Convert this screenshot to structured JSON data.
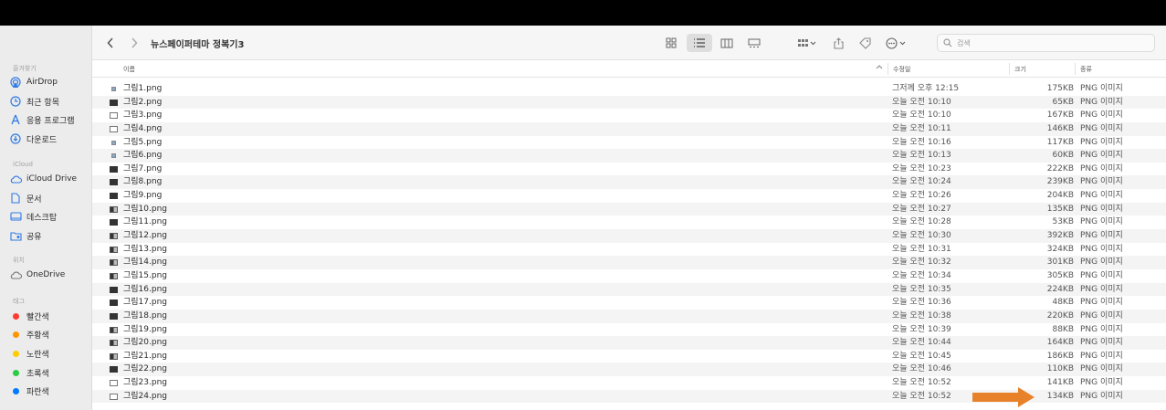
{
  "window": {
    "folder_title": "뉴스페이퍼테마 정복기3",
    "search_placeholder": "검색"
  },
  "sidebar": {
    "sections": {
      "favorites": "즐겨찾기",
      "icloud": "iCloud",
      "locations": "위치",
      "tags": "태그"
    },
    "favorites": [
      {
        "label": "AirDrop",
        "icon": "airdrop-icon"
      },
      {
        "label": "최근 항목",
        "icon": "clock-icon"
      },
      {
        "label": "응용 프로그램",
        "icon": "applications-icon"
      },
      {
        "label": "다운로드",
        "icon": "download-icon"
      }
    ],
    "icloud": [
      {
        "label": "iCloud Drive",
        "icon": "cloud-icon"
      },
      {
        "label": "문서",
        "icon": "document-icon"
      },
      {
        "label": "데스크탑",
        "icon": "desktop-icon"
      },
      {
        "label": "공유",
        "icon": "shared-folder-icon"
      }
    ],
    "locations": [
      {
        "label": "OneDrive",
        "icon": "cloud-icon"
      }
    ],
    "tags": [
      {
        "label": "빨간색",
        "color": "#ff3b30"
      },
      {
        "label": "주황색",
        "color": "#ff9500"
      },
      {
        "label": "노란색",
        "color": "#ffcc00"
      },
      {
        "label": "초록색",
        "color": "#28cd41"
      },
      {
        "label": "파란색",
        "color": "#007aff"
      }
    ]
  },
  "columns": {
    "name": "이름",
    "date": "수정일",
    "size": "크기",
    "kind": "종류"
  },
  "files": [
    {
      "name": "그림1.png",
      "date": "그저께 오후 12:15",
      "size": "175KB",
      "kind": "PNG 이미지",
      "thumb": "tiny"
    },
    {
      "name": "그림2.png",
      "date": "오늘 오전 10:10",
      "size": "65KB",
      "kind": "PNG 이미지",
      "thumb": "dark"
    },
    {
      "name": "그림3.png",
      "date": "오늘 오전 10:10",
      "size": "167KB",
      "kind": "PNG 이미지",
      "thumb": "light"
    },
    {
      "name": "그림4.png",
      "date": "오늘 오전 10:11",
      "size": "146KB",
      "kind": "PNG 이미지",
      "thumb": "light"
    },
    {
      "name": "그림5.png",
      "date": "오늘 오전 10:16",
      "size": "117KB",
      "kind": "PNG 이미지",
      "thumb": "tiny"
    },
    {
      "name": "그림6.png",
      "date": "오늘 오전 10:13",
      "size": "60KB",
      "kind": "PNG 이미지",
      "thumb": "tiny"
    },
    {
      "name": "그림7.png",
      "date": "오늘 오전 10:23",
      "size": "222KB",
      "kind": "PNG 이미지",
      "thumb": "dark"
    },
    {
      "name": "그림8.png",
      "date": "오늘 오전 10:24",
      "size": "239KB",
      "kind": "PNG 이미지",
      "thumb": "dark"
    },
    {
      "name": "그림9.png",
      "date": "오늘 오전 10:26",
      "size": "204KB",
      "kind": "PNG 이미지",
      "thumb": "dark"
    },
    {
      "name": "그림10.png",
      "date": "오늘 오전 10:27",
      "size": "135KB",
      "kind": "PNG 이미지",
      "thumb": "mid"
    },
    {
      "name": "그림11.png",
      "date": "오늘 오전 10:28",
      "size": "53KB",
      "kind": "PNG 이미지",
      "thumb": "dark"
    },
    {
      "name": "그림12.png",
      "date": "오늘 오전 10:30",
      "size": "392KB",
      "kind": "PNG 이미지",
      "thumb": "mid"
    },
    {
      "name": "그림13.png",
      "date": "오늘 오전 10:31",
      "size": "324KB",
      "kind": "PNG 이미지",
      "thumb": "mid"
    },
    {
      "name": "그림14.png",
      "date": "오늘 오전 10:32",
      "size": "301KB",
      "kind": "PNG 이미지",
      "thumb": "mid"
    },
    {
      "name": "그림15.png",
      "date": "오늘 오전 10:34",
      "size": "305KB",
      "kind": "PNG 이미지",
      "thumb": "mid"
    },
    {
      "name": "그림16.png",
      "date": "오늘 오전 10:35",
      "size": "224KB",
      "kind": "PNG 이미지",
      "thumb": "dark"
    },
    {
      "name": "그림17.png",
      "date": "오늘 오전 10:36",
      "size": "48KB",
      "kind": "PNG 이미지",
      "thumb": "dark"
    },
    {
      "name": "그림18.png",
      "date": "오늘 오전 10:38",
      "size": "220KB",
      "kind": "PNG 이미지",
      "thumb": "dark"
    },
    {
      "name": "그림19.png",
      "date": "오늘 오전 10:39",
      "size": "88KB",
      "kind": "PNG 이미지",
      "thumb": "mid"
    },
    {
      "name": "그림20.png",
      "date": "오늘 오전 10:44",
      "size": "164KB",
      "kind": "PNG 이미지",
      "thumb": "mid"
    },
    {
      "name": "그림21.png",
      "date": "오늘 오전 10:45",
      "size": "186KB",
      "kind": "PNG 이미지",
      "thumb": "mid"
    },
    {
      "name": "그림22.png",
      "date": "오늘 오전 10:46",
      "size": "110KB",
      "kind": "PNG 이미지",
      "thumb": "dark"
    },
    {
      "name": "그림23.png",
      "date": "오늘 오전 10:52",
      "size": "141KB",
      "kind": "PNG 이미지",
      "thumb": "light"
    },
    {
      "name": "그림24.png",
      "date": "오늘 오전 10:52",
      "size": "134KB",
      "kind": "PNG 이미지",
      "thumb": "light"
    }
  ],
  "annotation": {
    "color": "#e8822a",
    "icon": "arrow-right-icon"
  }
}
